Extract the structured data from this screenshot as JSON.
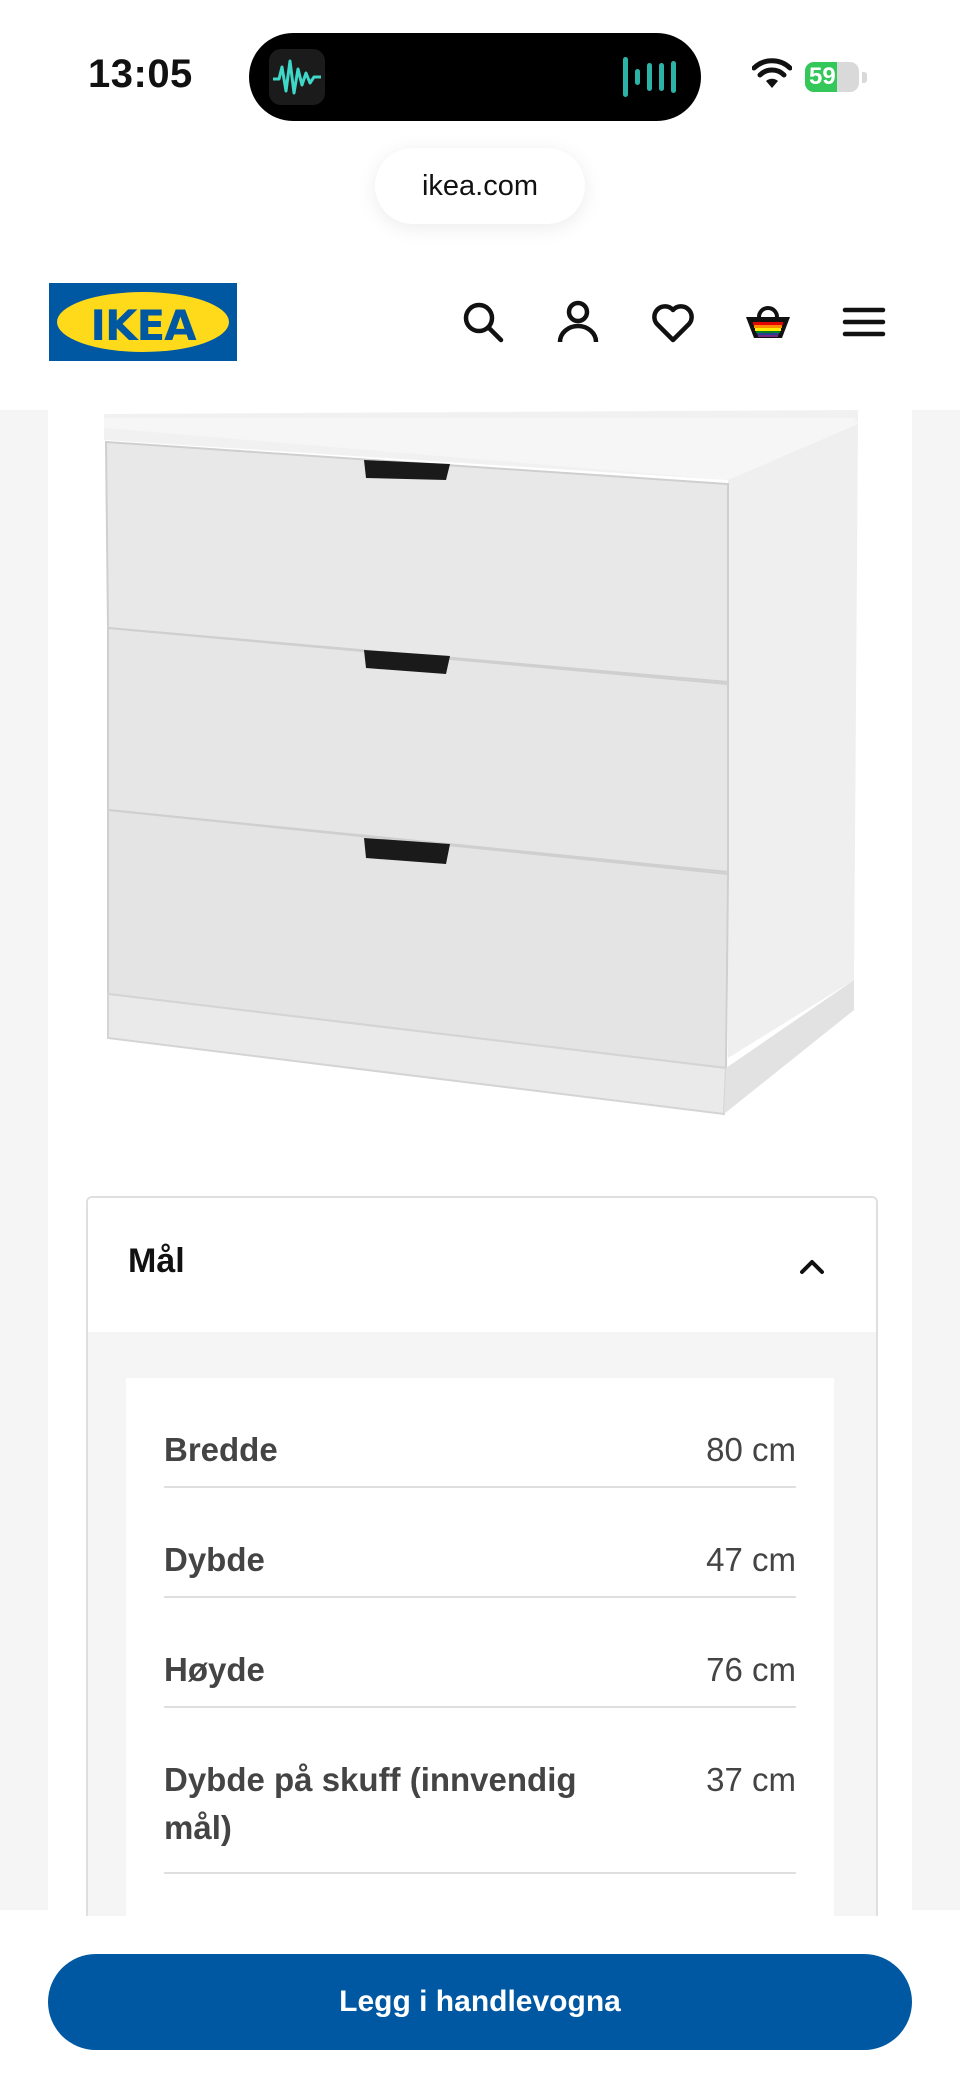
{
  "status_bar": {
    "time": "13:05",
    "battery_level": "59"
  },
  "browser": {
    "url": "ikea.com"
  },
  "header": {
    "logo_text": "IKEA",
    "icons": [
      "search-icon",
      "account-icon",
      "heart-icon",
      "cart-icon",
      "menu-icon"
    ]
  },
  "product": {
    "image": "white-three-drawer-chest"
  },
  "dimensions": {
    "title": "Mål",
    "rows": [
      {
        "label": "Bredde",
        "value": "80 cm"
      },
      {
        "label": "Dybde",
        "value": "47 cm"
      },
      {
        "label": "Høyde",
        "value": "76 cm"
      },
      {
        "label": "Dybde på skuff (innvendig mål)",
        "value": "37 cm"
      }
    ]
  },
  "cta": {
    "add_to_cart_label": "Legg i handlevogna"
  },
  "colors": {
    "ikea_blue": "#0058a3",
    "ikea_yellow": "#ffda1a",
    "battery_green": "#34c759"
  }
}
